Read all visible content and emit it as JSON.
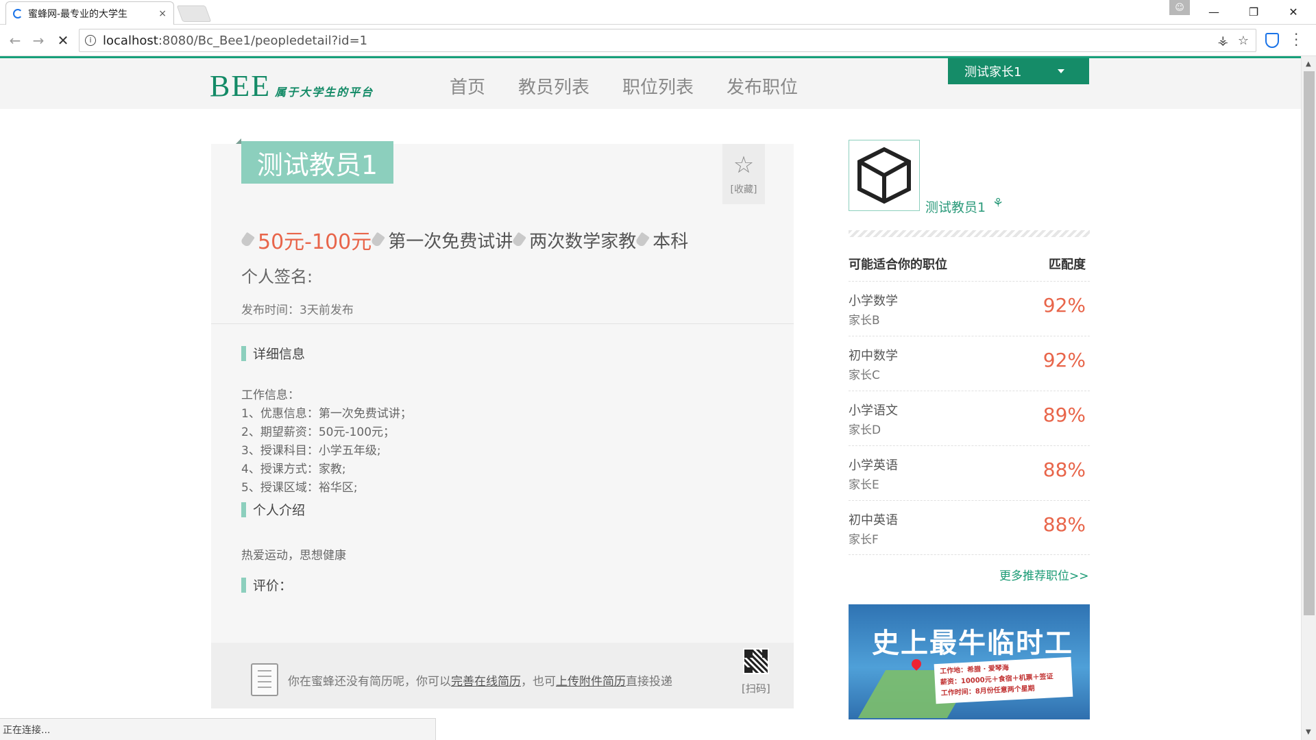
{
  "browser": {
    "tab_title": "蜜蜂网-最专业的大学生​",
    "tab_close": "×",
    "url_host": "localhost",
    "url_path": ":8080/Bc_Bee1/peopledetail?id=1",
    "status_text": "正在连接..."
  },
  "header": {
    "brand": "BEE",
    "slogan": "属于大学生的平台",
    "nav": [
      "首页",
      "教员列表",
      "职位列表",
      "发布职位"
    ],
    "user_menu_label": "测试家长1"
  },
  "teacher": {
    "name": "测试教员1",
    "favorite_label": "[收藏]",
    "price": "50元-100元",
    "tags": [
      "第一次免费试讲",
      "两次数学家教",
      "本科"
    ],
    "signature_label": "个人签名:",
    "publish_time": "发布时间：3天前发布"
  },
  "details": {
    "section_title": "详细信息",
    "lines": [
      "工作信息：",
      "1、优惠信息：第一次免费试讲；",
      "2、期望薪资：50元-100元；",
      "3、授课科目：小学五年级;",
      "4、授课方式：家教;",
      "5、授课区域：裕华区;"
    ],
    "intro_title": "个人介绍",
    "intro_text": "热爱运动，思想健康",
    "review_title": "评价："
  },
  "resume": {
    "text_before": "你在蜜蜂还没有简历呢，你可以",
    "link_online": "完善在线简历",
    "text_middle": "，也可",
    "link_upload": "上传附件简历",
    "text_after": "直接投递",
    "qr_label": "[扫码]"
  },
  "sidebar": {
    "teacher_name": "测试教员1",
    "jobs_header": "可能适合你的职位",
    "match_header": "匹配度",
    "jobs": [
      {
        "title": "小学数学",
        "parent": "家长B",
        "match": "92%"
      },
      {
        "title": "初中数学",
        "parent": "家长C",
        "match": "92%"
      },
      {
        "title": "小学语文",
        "parent": "家长D",
        "match": "89%"
      },
      {
        "title": "小学英语",
        "parent": "家长E",
        "match": "88%"
      },
      {
        "title": "初中英语",
        "parent": "家长F",
        "match": "88%"
      }
    ],
    "more_link": "更多推荐职位>>",
    "banner": {
      "title": "史上最牛临时工",
      "line1": "工作地：希腊 · 爱琴海",
      "line2": "薪资：10000元＋食宿＋机票＋签证",
      "line3": "工作时间：8月份任意两个星期"
    }
  },
  "colors": {
    "brand_green": "#158c68",
    "accent_mint": "#8ccfbd",
    "price_orange": "#e8654a"
  }
}
